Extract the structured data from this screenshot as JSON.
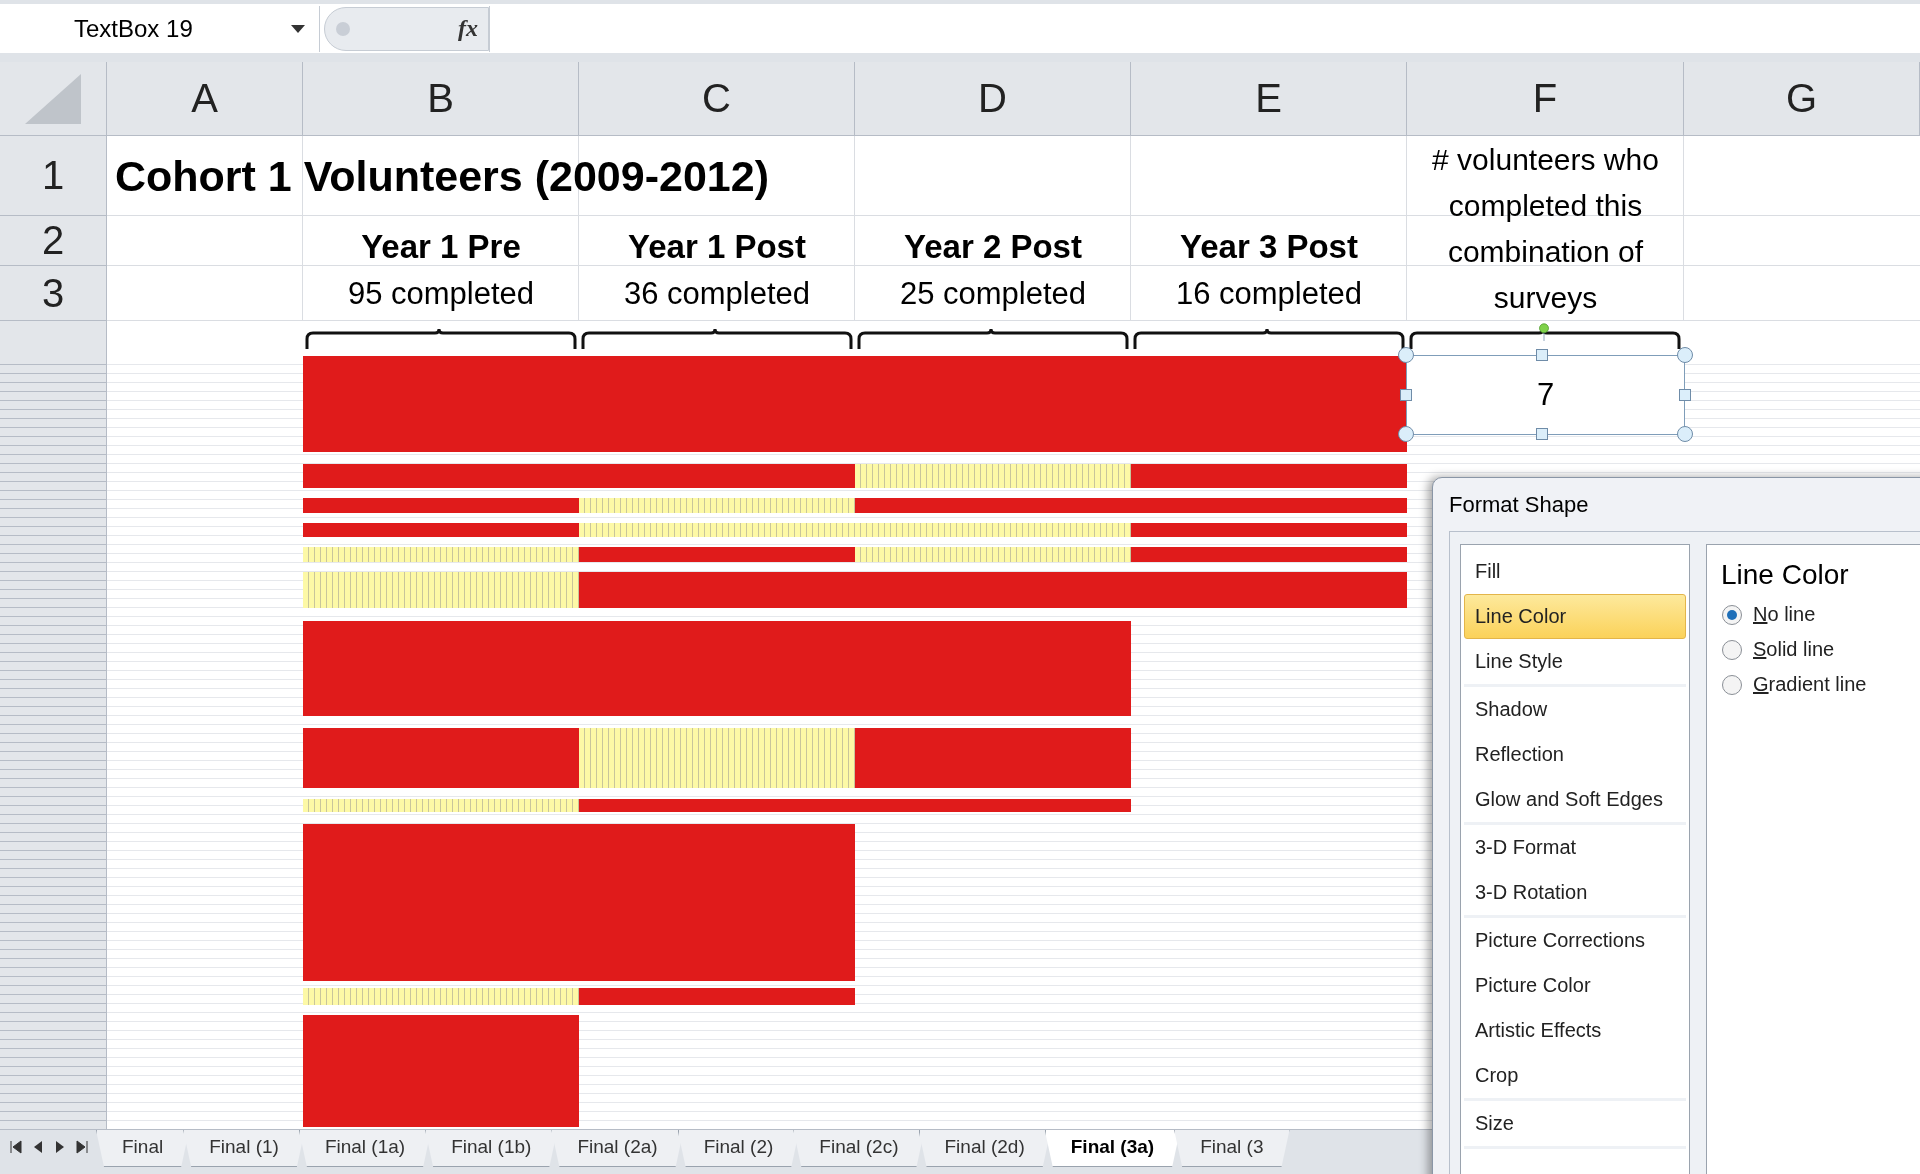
{
  "formula_bar": {
    "name_box": "TextBox 19",
    "function_button": "fx"
  },
  "columns": [
    "A",
    "B",
    "C",
    "D",
    "E",
    "F",
    "G"
  ],
  "rows": [
    "1",
    "2",
    "3"
  ],
  "sheet": {
    "title": "Cohort 1 Volunteers (2009-2012)",
    "surveys": [
      {
        "name": "Year 1 Pre",
        "count": "95 completed"
      },
      {
        "name": "Year 1 Post",
        "count": "36 completed"
      },
      {
        "name": "Year 2 Post",
        "count": "25 completed"
      },
      {
        "name": "Year 3 Post",
        "count": "16 completed"
      }
    ],
    "combination_header": "# volunteers who completed this combination of surveys",
    "bars": [
      {
        "cells": [
          {
            "completed": true
          },
          {
            "completed": true
          },
          {
            "completed": true
          },
          {
            "completed": true
          }
        ]
      },
      {
        "cells": [
          {
            "completed": true
          },
          {
            "completed": true
          },
          {
            "completed": false
          },
          {
            "completed": true
          }
        ]
      },
      {
        "cells": [
          {
            "completed": true
          },
          {
            "completed": false
          },
          {
            "completed": true
          },
          {
            "completed": true
          }
        ]
      },
      {
        "cells": [
          {
            "completed": true
          },
          {
            "completed": false
          },
          {
            "completed": false
          },
          {
            "completed": true
          }
        ]
      },
      {
        "cells": [
          {
            "completed": false
          },
          {
            "completed": true
          },
          {
            "completed": false
          },
          {
            "completed": true
          }
        ]
      },
      {
        "cells": [
          {
            "completed": false
          },
          {
            "completed": true
          },
          {
            "completed": true
          },
          {
            "completed": true
          }
        ]
      },
      {
        "cells": [
          {
            "completed": true
          },
          {
            "completed": true
          },
          {
            "completed": true
          }
        ]
      },
      {
        "cells": [
          {
            "completed": true
          },
          {
            "completed": false
          },
          {
            "completed": true
          }
        ]
      },
      {
        "cells": [
          {
            "completed": false
          },
          {
            "completed": true
          },
          {
            "completed": true
          }
        ]
      },
      {
        "cells": [
          {
            "completed": true
          },
          {
            "completed": true
          }
        ]
      },
      {
        "cells": [
          {
            "completed": false
          },
          {
            "completed": true
          }
        ]
      },
      {
        "cells": [
          {
            "completed": true
          }
        ]
      }
    ],
    "text_box": "7"
  },
  "sheet_tabs": [
    {
      "label": "Final",
      "selected": false
    },
    {
      "label": "Final (1)",
      "selected": false
    },
    {
      "label": "Final (1a)",
      "selected": false
    },
    {
      "label": "Final (1b)",
      "selected": false
    },
    {
      "label": "Final (2a)",
      "selected": false
    },
    {
      "label": "Final (2)",
      "selected": false
    },
    {
      "label": "Final (2c)",
      "selected": false
    },
    {
      "label": "Final (2d)",
      "selected": false
    },
    {
      "label": "Final (3a)",
      "selected": true
    },
    {
      "label": "Final (3",
      "selected": false
    }
  ],
  "format_panel": {
    "title": "Format Shape",
    "groups": [
      {
        "items": [
          {
            "label": "Fill",
            "selected": false
          },
          {
            "label": "Line Color",
            "selected": true
          },
          {
            "label": "Line Style",
            "selected": false
          }
        ]
      },
      {
        "items": [
          {
            "label": "Shadow",
            "selected": false
          },
          {
            "label": "Reflection",
            "selected": false
          },
          {
            "label": "Glow and Soft Edges",
            "selected": false
          }
        ]
      },
      {
        "items": [
          {
            "label": "3-D Format",
            "selected": false
          },
          {
            "label": "3-D Rotation",
            "selected": false
          }
        ]
      },
      {
        "items": [
          {
            "label": "Picture Corrections",
            "selected": false
          },
          {
            "label": "Picture Color",
            "selected": false
          },
          {
            "label": "Artistic Effects",
            "selected": false
          },
          {
            "label": "Crop",
            "selected": false
          }
        ]
      },
      {
        "items": [
          {
            "label": "Size",
            "selected": false
          }
        ]
      }
    ],
    "heading": "Line Color",
    "options": [
      {
        "label": "No line",
        "selected": true
      },
      {
        "label": "Solid line",
        "selected": false
      },
      {
        "label": "Gradient line",
        "selected": false
      }
    ]
  }
}
